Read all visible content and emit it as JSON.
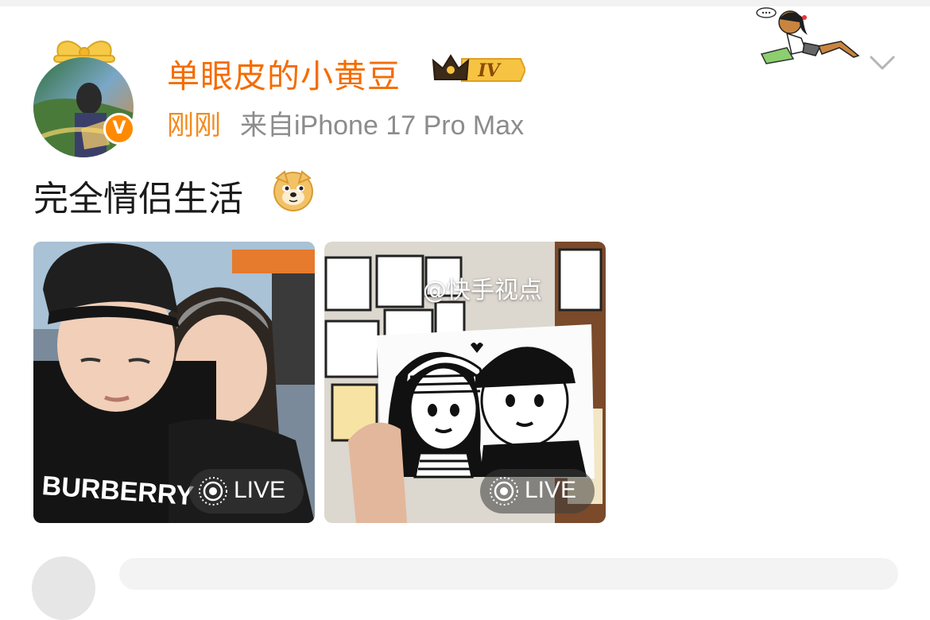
{
  "post": {
    "username": "单眼皮的小黄豆",
    "vip_level": "IV",
    "time": "刚刚",
    "source": "来自iPhone 17 Pro Max",
    "text": "完全情侣生活",
    "emoji": "doge-emoji"
  },
  "photos": [
    {
      "live_label": "LIVE"
    },
    {
      "live_label": "LIVE",
      "watermark": "@快手视点"
    }
  ],
  "colors": {
    "username": "#f56c00",
    "time": "#f28a1d",
    "source": "#8c8c8c",
    "verified_badge": "#ff8a00"
  }
}
